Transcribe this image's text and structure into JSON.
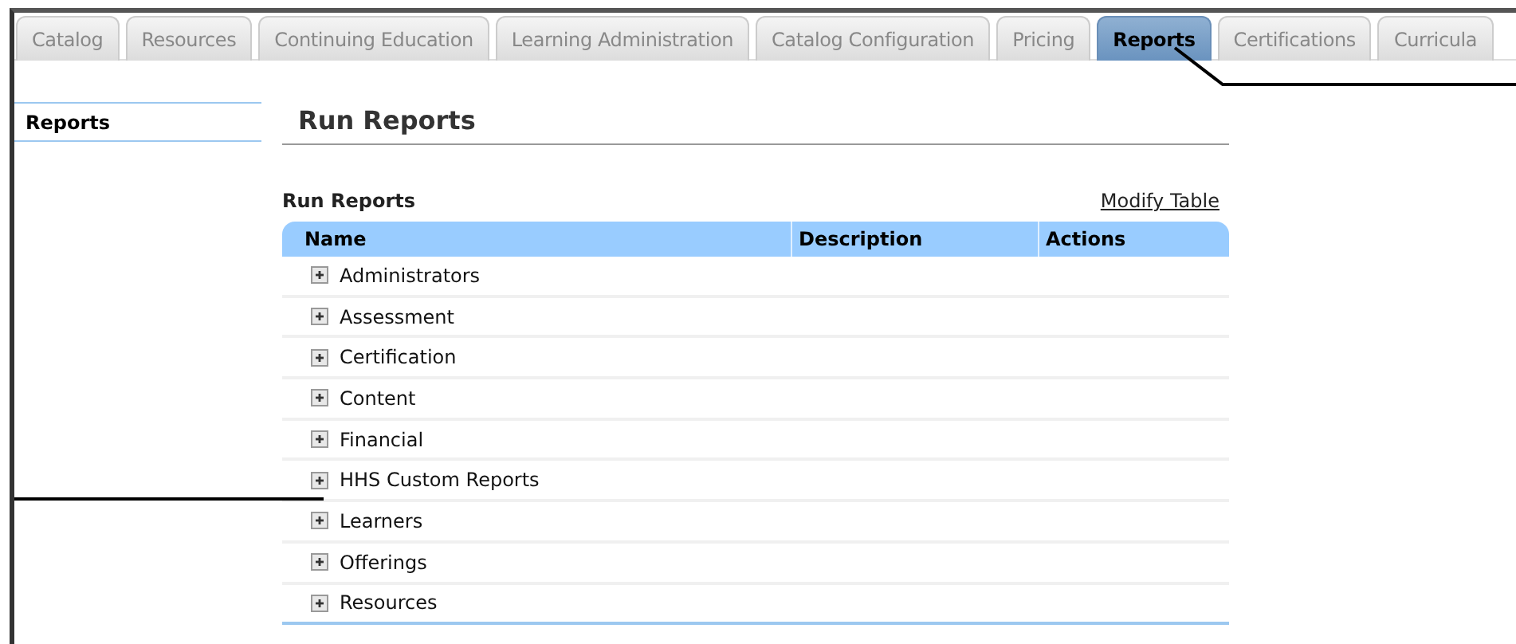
{
  "tabs": [
    {
      "label": "Catalog",
      "selected": false
    },
    {
      "label": "Resources",
      "selected": false
    },
    {
      "label": "Continuing Education",
      "selected": false
    },
    {
      "label": "Learning Administration",
      "selected": false
    },
    {
      "label": "Catalog Configuration",
      "selected": false
    },
    {
      "label": "Pricing",
      "selected": false
    },
    {
      "label": "Reports",
      "selected": true
    },
    {
      "label": "Certifications",
      "selected": false
    },
    {
      "label": "Curricula",
      "selected": false
    }
  ],
  "sidebar": {
    "items": [
      {
        "label": "Reports",
        "selected": true
      }
    ]
  },
  "page_title": "Run Reports",
  "table": {
    "caption": "Run Reports",
    "modify_link": "Modify Table",
    "columns": [
      "Name",
      "Description",
      "Actions"
    ],
    "rows": [
      {
        "name": "Administrators",
        "expanded": false
      },
      {
        "name": "Assessment",
        "expanded": false
      },
      {
        "name": "Certification",
        "expanded": false
      },
      {
        "name": "Content",
        "expanded": false
      },
      {
        "name": "Financial",
        "expanded": false
      },
      {
        "name": "HHS Custom Reports",
        "expanded": false
      },
      {
        "name": "Learners",
        "expanded": false
      },
      {
        "name": "Offerings",
        "expanded": false
      },
      {
        "name": "Resources",
        "expanded": false
      }
    ]
  }
}
